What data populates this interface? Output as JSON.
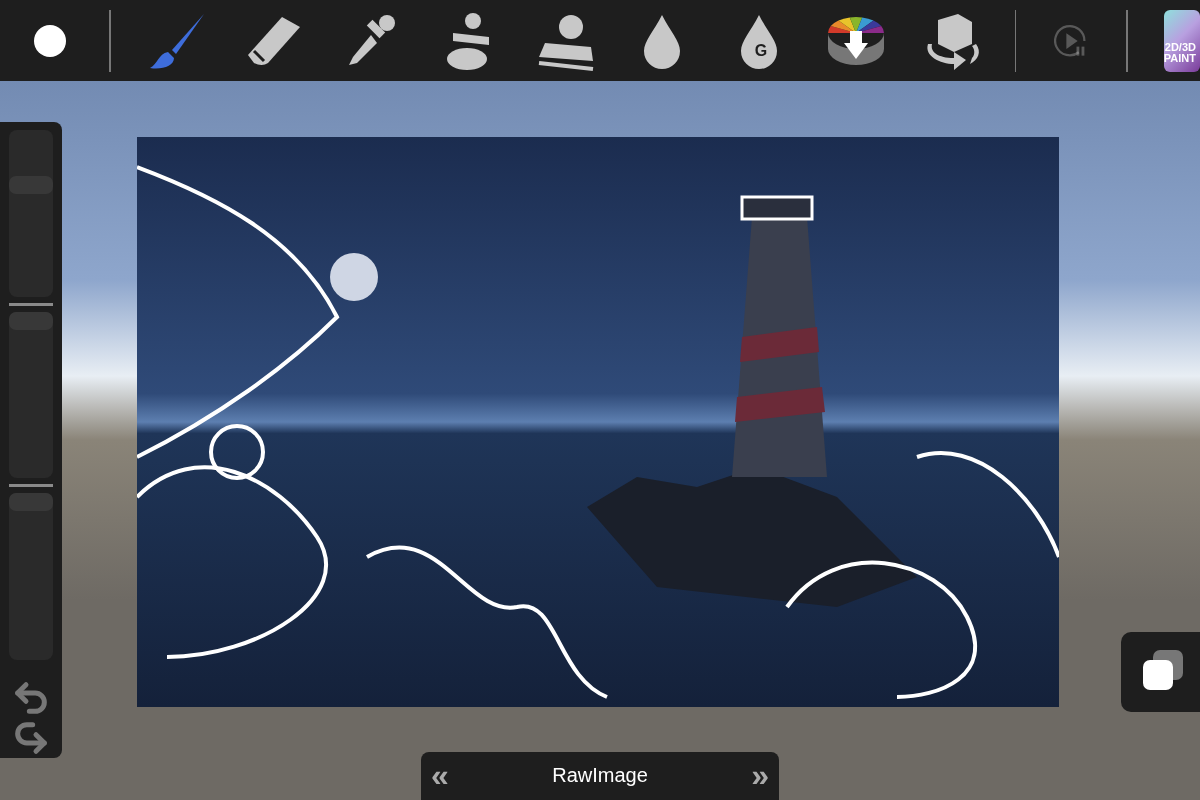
{
  "toolbar": {
    "tools": [
      {
        "kind": "brush",
        "selected": true
      },
      {
        "kind": "eraser",
        "selected": false
      },
      {
        "kind": "pipette",
        "selected": false
      },
      {
        "kind": "stamp-paint",
        "selected": false
      },
      {
        "kind": "stamp",
        "selected": false
      },
      {
        "kind": "drop",
        "selected": false
      },
      {
        "kind": "drop",
        "label": "G",
        "selected": false
      },
      {
        "kind": "color-wheel",
        "selected": false
      },
      {
        "kind": "cube-rotate",
        "selected": false
      }
    ],
    "playback": {
      "disabled": true
    },
    "logo": {
      "lines": [
        "2D/3D",
        "PAINT"
      ]
    }
  },
  "sliders": [
    {
      "level": 0.7
    },
    {
      "level": 1
    },
    {
      "level": 1
    }
  ],
  "bottom_bar": {
    "prev": "«",
    "title": "RawImage",
    "next": "»"
  }
}
